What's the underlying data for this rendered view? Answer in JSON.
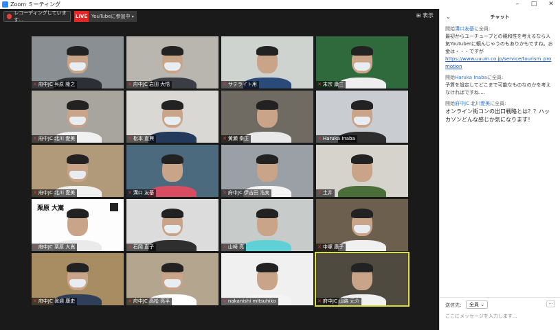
{
  "window": {
    "title": "Zoom ミーティング",
    "min": "–",
    "max": "□",
    "close": "✕"
  },
  "toolbar": {
    "recording": "レコーディングしています...",
    "live": "LIVE",
    "youtube": "YouTubeに参加中",
    "view": "表示"
  },
  "participants": [
    {
      "name": "府中JC 呉原 隆之"
    },
    {
      "name": "府中JC 岩田 大悟"
    },
    {
      "name": "サテライト用"
    },
    {
      "name": "末宗 康三"
    },
    {
      "name": "府中JC 北川 愛美"
    },
    {
      "name": "松本 直興"
    },
    {
      "name": "黄瀬 秦正"
    },
    {
      "name": "Haruka Inaba"
    },
    {
      "name": "府中JC 北川 愛美"
    },
    {
      "name": "溝口 友基"
    },
    {
      "name": "府中JC 伊吉田 浩実"
    },
    {
      "name": "土井"
    },
    {
      "name": "府中JC 栗原 大嵩"
    },
    {
      "name": "石岡 直子"
    },
    {
      "name": "山崎 亮"
    },
    {
      "name": "中塚 康子"
    },
    {
      "name": "府中JC 眞週 康史"
    },
    {
      "name": "府中JC 高松 亮平"
    },
    {
      "name": "nakanishi mitsuhiko"
    },
    {
      "name": "府中JC 山路 元介"
    }
  ],
  "card": {
    "name": "栗原 大嵩"
  },
  "chat": {
    "title": "チャット",
    "messages": [
      {
        "from_label": "開始",
        "from": "溝口友基",
        "to": "に全員:",
        "text": "最初からユーチューブとの親和性を考えるなら人気Youtuberに頼んじゃうのもありかもですね。お金は・・・ですが",
        "link": "https://www.uuum.co.jp/service/tourism_promotion"
      },
      {
        "from_label": "開始",
        "from": "Haruka Inaba",
        "to": "に全員:",
        "text": "予算を設定してどこまで可能なものなのかを考えなければですね....",
        "link": ""
      },
      {
        "from_label": "開始",
        "from": "府中JC 北川愛美",
        "to": "に全員:",
        "text": "オンライン街コンの出口戦略とは？？ハッカソンどんな感じか気になります！",
        "link": ""
      }
    ],
    "send_to_label": "送信先:",
    "send_to_value": "全員 ⌄",
    "more": "···",
    "placeholder": "ここにメッセージを入力します..."
  }
}
